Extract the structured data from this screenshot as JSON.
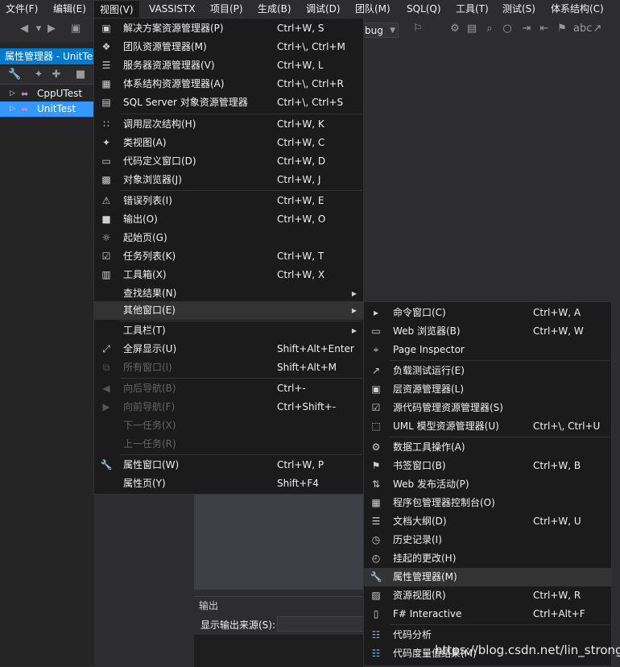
{
  "menubar": {
    "items": [
      "文件(F)",
      "编辑(E)",
      "视图(V)",
      "VASSISTX",
      "项目(P)",
      "生成(B)",
      "调试(D)",
      "团队(M)",
      "SQL(Q)",
      "工具(T)",
      "测试(S)",
      "体系结构(C)"
    ]
  },
  "toolbar": {
    "config": "bug"
  },
  "property_panel": {
    "title": "属性管理器 - UnitTest",
    "tree": [
      "CppUTest",
      "UnitTest"
    ]
  },
  "view_menu": {
    "items": [
      {
        "label": "解决方案资源管理器(P)",
        "shortcut": "Ctrl+W, S",
        "icon": "solution-explorer-icon"
      },
      {
        "label": "团队资源管理器(M)",
        "shortcut": "Ctrl+\\, Ctrl+M",
        "icon": "team-explorer-icon"
      },
      {
        "label": "服务器资源管理器(V)",
        "shortcut": "Ctrl+W, L",
        "icon": "server-explorer-icon"
      },
      {
        "label": "体系结构资源管理器(A)",
        "shortcut": "Ctrl+\\, Ctrl+R",
        "icon": "architecture-explorer-icon"
      },
      {
        "label": "SQL Server 对象资源管理器",
        "shortcut": "Ctrl+\\, Ctrl+S",
        "icon": "sql-server-icon"
      },
      {
        "label": "调用层次结构(H)",
        "shortcut": "Ctrl+W, K",
        "icon": "call-hierarchy-icon"
      },
      {
        "label": "类视图(A)",
        "shortcut": "Ctrl+W, C",
        "icon": "class-view-icon"
      },
      {
        "label": "代码定义窗口(D)",
        "shortcut": "Ctrl+W, D",
        "icon": "code-definition-icon"
      },
      {
        "label": "对象浏览器(J)",
        "shortcut": "Ctrl+W, J",
        "icon": "object-browser-icon"
      },
      {
        "label": "错误列表(I)",
        "shortcut": "Ctrl+W, E",
        "icon": "error-list-icon"
      },
      {
        "label": "输出(O)",
        "shortcut": "Ctrl+W, O",
        "icon": "output-icon"
      },
      {
        "label": "起始页(G)",
        "shortcut": "",
        "icon": "start-page-icon"
      },
      {
        "label": "任务列表(K)",
        "shortcut": "Ctrl+W, T",
        "icon": "task-list-icon"
      },
      {
        "label": "工具箱(X)",
        "shortcut": "Ctrl+W, X",
        "icon": "toolbox-icon"
      },
      {
        "label": "查找结果(N)",
        "shortcut": "",
        "icon": ""
      },
      {
        "label": "其他窗口(E)",
        "shortcut": "",
        "icon": ""
      },
      {
        "label": "工具栏(T)",
        "shortcut": "",
        "icon": ""
      },
      {
        "label": "全屏显示(U)",
        "shortcut": "Shift+Alt+Enter",
        "icon": "full-screen-icon"
      },
      {
        "label": "所有窗口(l)",
        "shortcut": "Shift+Alt+M",
        "icon": "all-windows-icon"
      },
      {
        "label": "向后导航(B)",
        "shortcut": "Ctrl+-",
        "icon": "navigate-back-icon"
      },
      {
        "label": "向前导航(F)",
        "shortcut": "Ctrl+Shift+-",
        "icon": "navigate-forward-icon"
      },
      {
        "label": "下一任务(X)",
        "shortcut": "",
        "icon": ""
      },
      {
        "label": "上一任务(R)",
        "shortcut": "",
        "icon": ""
      },
      {
        "label": "属性窗口(W)",
        "shortcut": "Ctrl+W, P",
        "icon": "properties-window-icon"
      },
      {
        "label": "属性页(Y)",
        "shortcut": "Shift+F4",
        "icon": ""
      }
    ]
  },
  "other_windows_menu": {
    "items": [
      {
        "label": "命令窗口(C)",
        "shortcut": "Ctrl+W, A",
        "icon": "command-window-icon"
      },
      {
        "label": "Web 浏览器(B)",
        "shortcut": "Ctrl+W, W",
        "icon": "web-browser-icon"
      },
      {
        "label": "Page Inspector",
        "shortcut": "",
        "icon": "page-inspector-icon"
      },
      {
        "label": "负载测试运行(E)",
        "shortcut": "",
        "icon": "load-test-icon"
      },
      {
        "label": "层资源管理器(L)",
        "shortcut": "",
        "icon": "layer-explorer-icon"
      },
      {
        "label": "源代码管理资源管理器(S)",
        "shortcut": "",
        "icon": "source-control-icon"
      },
      {
        "label": "UML 模型资源管理器(U)",
        "shortcut": "Ctrl+\\, Ctrl+U",
        "icon": "uml-explorer-icon"
      },
      {
        "label": "数据工具操作(A)",
        "shortcut": "",
        "icon": "data-tools-icon"
      },
      {
        "label": "书签窗口(B)",
        "shortcut": "Ctrl+W, B",
        "icon": "bookmark-icon"
      },
      {
        "label": "Web 发布活动(P)",
        "shortcut": "",
        "icon": "web-publish-icon"
      },
      {
        "label": "程序包管理器控制台(O)",
        "shortcut": "",
        "icon": "package-manager-icon"
      },
      {
        "label": "文档大纲(D)",
        "shortcut": "Ctrl+W, U",
        "icon": "document-outline-icon"
      },
      {
        "label": "历史记录(I)",
        "shortcut": "",
        "icon": "history-icon"
      },
      {
        "label": "挂起的更改(H)",
        "shortcut": "",
        "icon": "pending-changes-icon"
      },
      {
        "label": "属性管理器(M)",
        "shortcut": "",
        "icon": "property-manager-icon"
      },
      {
        "label": "资源视图(R)",
        "shortcut": "Ctrl+W, R",
        "icon": "resource-view-icon"
      },
      {
        "label": "F# Interactive",
        "shortcut": "Ctrl+Alt+F",
        "icon": "fsharp-icon"
      },
      {
        "label": "代码分析",
        "shortcut": "",
        "icon": "code-analysis-icon"
      },
      {
        "label": "代码度量值结果(M)",
        "shortcut": "",
        "icon": "code-metrics-icon"
      }
    ]
  },
  "output_panel": {
    "title": "输出",
    "source_label": "显示输出来源(S):"
  },
  "watermark": "https://blog.csdn.net/lin_strong"
}
